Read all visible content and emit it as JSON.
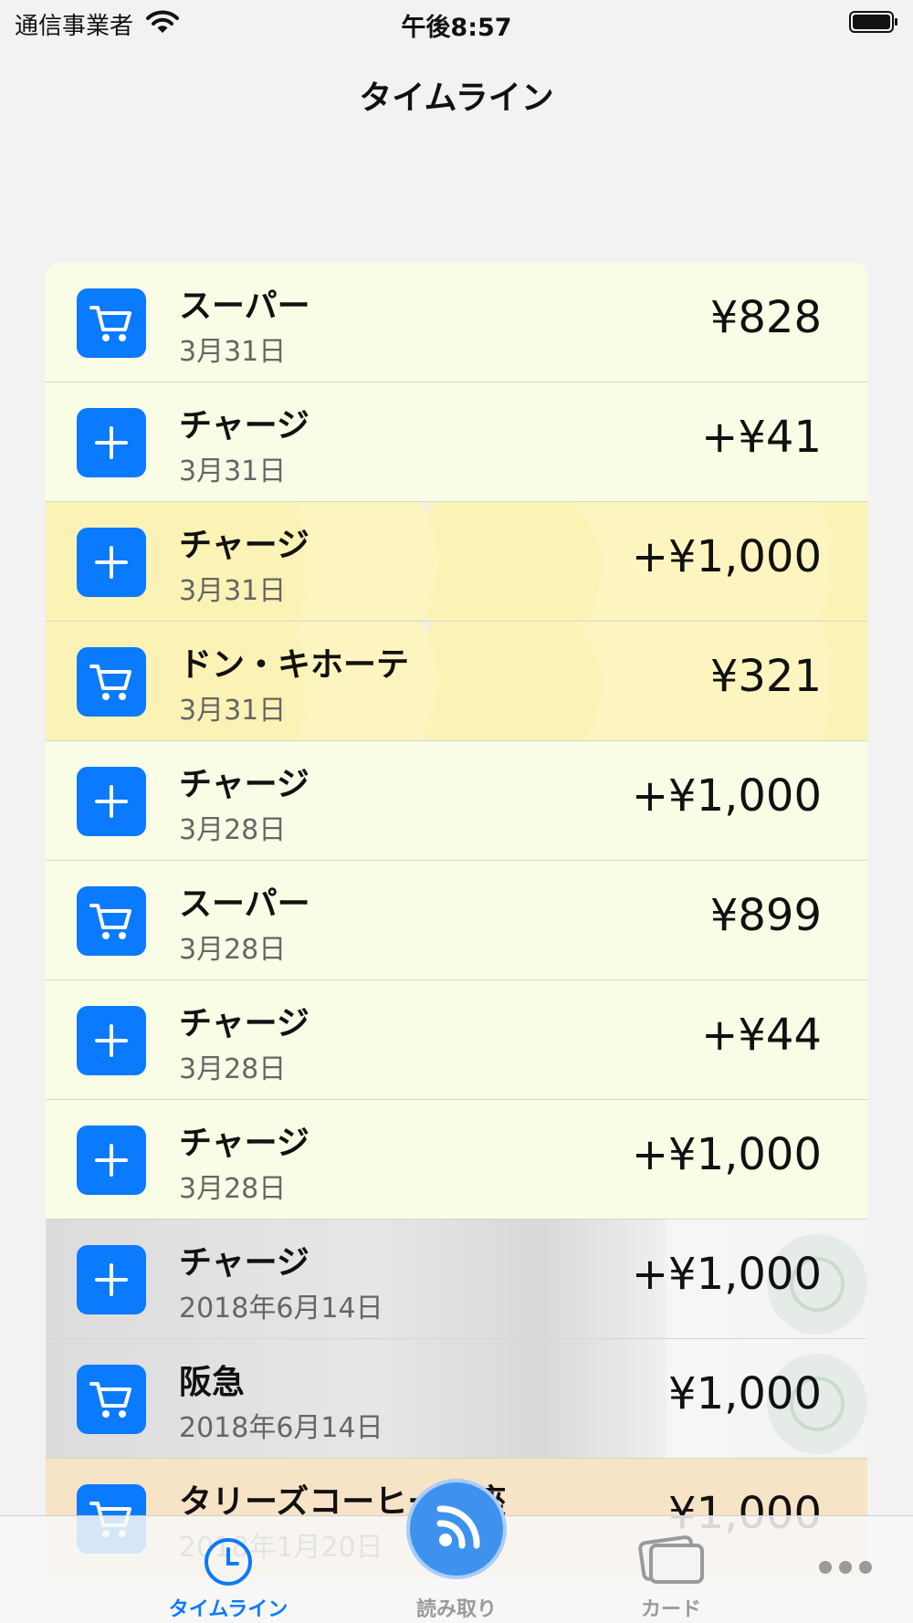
{
  "status_bar": {
    "carrier": "通信事業者",
    "time": "午後8:57",
    "wifi_icon": "wifi-icon",
    "battery_icon": "battery-icon"
  },
  "nav": {
    "title": "タイムライン"
  },
  "colors": {
    "accent": "#0a7aff",
    "nanaco_row": "#fafde6",
    "tullys_row": "#f7e3c6"
  },
  "transactions": [
    {
      "title": "スーパー",
      "date": "3月31日",
      "amount": "¥828",
      "icon": "cart-icon",
      "card": "nanaco"
    },
    {
      "title": "チャージ",
      "date": "3月31日",
      "amount": "+¥41",
      "icon": "plus-icon",
      "card": "nanaco"
    },
    {
      "title": "チャージ",
      "date": "3月31日",
      "amount": "+¥1,000",
      "icon": "plus-icon",
      "card": "yellow"
    },
    {
      "title": "ドン・キホーテ",
      "date": "3月31日",
      "amount": "¥321",
      "icon": "cart-icon",
      "card": "yellow"
    },
    {
      "title": "チャージ",
      "date": "3月28日",
      "amount": "+¥1,000",
      "icon": "plus-icon",
      "card": "nanaco"
    },
    {
      "title": "スーパー",
      "date": "3月28日",
      "amount": "¥899",
      "icon": "cart-icon",
      "card": "nanaco"
    },
    {
      "title": "チャージ",
      "date": "3月28日",
      "amount": "+¥44",
      "icon": "plus-icon",
      "card": "nanaco"
    },
    {
      "title": "チャージ",
      "date": "3月28日",
      "amount": "+¥1,000",
      "icon": "plus-icon",
      "card": "nanaco"
    },
    {
      "title": "チャージ",
      "date": "2018年6月14日",
      "amount": "+¥1,000",
      "icon": "plus-icon",
      "card": "starbucks"
    },
    {
      "title": "阪急",
      "date": "2018年6月14日",
      "amount": "¥1,000",
      "icon": "cart-icon",
      "card": "starbucks"
    },
    {
      "title": "タリーズコーヒー銀座",
      "date": "2018年1月20日",
      "amount": "¥1,000",
      "icon": "cart-icon",
      "card": "tullys"
    }
  ],
  "tab_bar": {
    "tabs": [
      {
        "label": "タイムライン",
        "icon": "clock-icon",
        "active": true
      },
      {
        "label": "読み取り",
        "icon": "nfc-read-icon",
        "active": false
      },
      {
        "label": "カード",
        "icon": "cards-icon",
        "active": false
      },
      {
        "label": "",
        "icon": "more-icon",
        "active": false
      }
    ]
  }
}
